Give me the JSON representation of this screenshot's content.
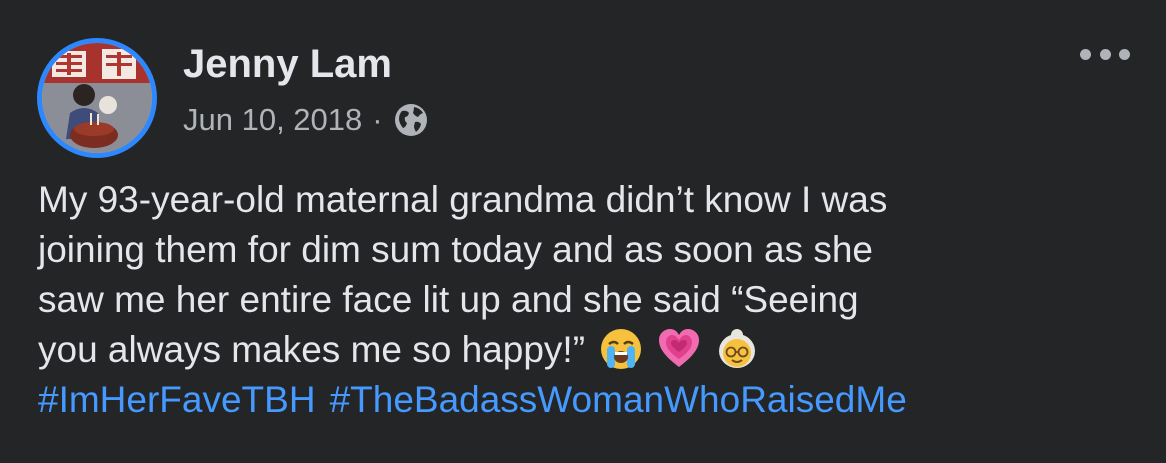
{
  "post": {
    "author_name": "Jenny Lam",
    "date": "Jun 10, 2018",
    "separator": "·",
    "audience_icon": "globe-icon",
    "more_icon": "more-options-icon",
    "text_lines": [
      "My 93-year-old maternal grandma didn’t know I was",
      "joining them for dim sum today and as soon as she",
      "saw me her entire face lit up and she said “Seeing",
      "you always makes me so happy!”"
    ],
    "emojis": [
      "loudly-crying-face-emoji",
      "growing-heart-emoji",
      "older-woman-emoji"
    ],
    "hashtags": [
      "#ImHerFaveTBH",
      "#TheBadassWomanWhoRaisedMe"
    ]
  },
  "colors": {
    "background": "#242526",
    "primary_text": "#e4e6eb",
    "secondary_text": "#b0b3b8",
    "link": "#4599ff",
    "avatar_ring": "#2d88ff"
  }
}
